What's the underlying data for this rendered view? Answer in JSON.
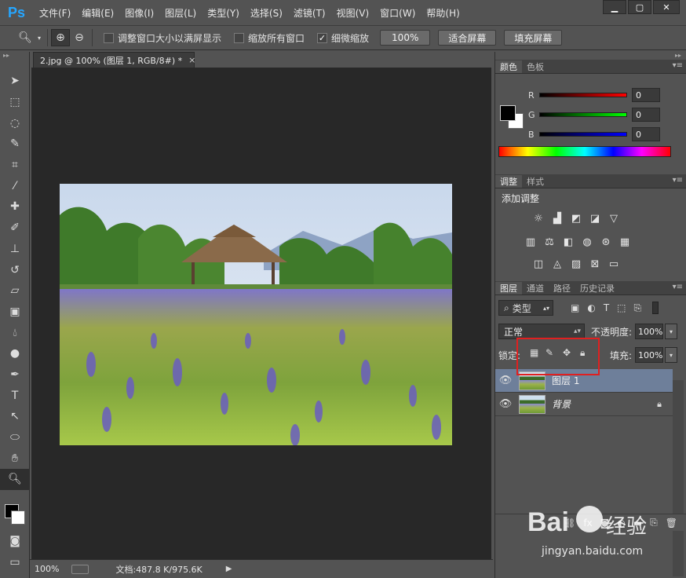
{
  "app": {
    "logo": "Ps"
  },
  "menu": [
    "文件(F)",
    "编辑(E)",
    "图像(I)",
    "图层(L)",
    "类型(Y)",
    "选择(S)",
    "滤镜(T)",
    "视图(V)",
    "窗口(W)",
    "帮助(H)"
  ],
  "window_controls": {
    "minimize": "▁",
    "maximize": "▢",
    "close": "✕"
  },
  "options": {
    "resize_windows": "调整窗口大小以满屏显示",
    "zoom_all": "缩放所有窗口",
    "scrubby_zoom": "细微缩放",
    "btn_100": "100%",
    "btn_fit": "适合屏幕",
    "btn_fill": "填充屏幕"
  },
  "document": {
    "tab_title": "2.jpg @ 100% (图层 1, RGB/8#) *",
    "close": "×"
  },
  "status": {
    "zoom": "100%",
    "doc_size": "文档:487.8 K/975.6K"
  },
  "panels": {
    "color_tabs": [
      "颜色",
      "色板"
    ],
    "rgb": [
      {
        "label": "R",
        "value": "0"
      },
      {
        "label": "G",
        "value": "0"
      },
      {
        "label": "B",
        "value": "0"
      }
    ],
    "adjust_tabs": [
      "调整",
      "样式"
    ],
    "adjust_title": "添加调整",
    "layers_tabs": [
      "图层",
      "通道",
      "路径",
      "历史记录"
    ],
    "kind": "类型",
    "blend_mode": "正常",
    "opacity_label": "不透明度:",
    "opacity": "100%",
    "lock_label": "锁定:",
    "fill_label": "填充:",
    "fill": "100%",
    "layers": [
      {
        "name": "图层 1",
        "selected": true
      },
      {
        "name": "背景",
        "selected": false,
        "locked": true
      }
    ]
  },
  "watermark": {
    "brand": "Bai",
    "brand2": "经验",
    "url": "jingyan.baidu.com"
  },
  "colors": {
    "accent": "#26a6ff",
    "selected_layer": "#6e7f9a",
    "highlight_box": "#e02020"
  }
}
